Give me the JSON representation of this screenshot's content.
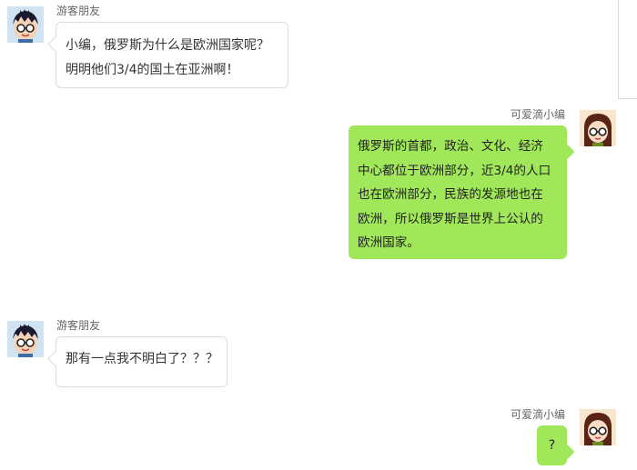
{
  "messages": [
    {
      "sender": "游客朋友",
      "side": "left",
      "lines": [
        "小编，俄罗斯为什么是欧洲国家呢？",
        "明明他们3/4的国土在亚洲啊！"
      ]
    },
    {
      "sender": "可爱滴小编",
      "side": "right",
      "lines": [
        "俄罗斯的首都，政治、文化、经济",
        "中心都位于欧洲部分，近3/4的人口",
        "也在欧洲部分，民族的发源地也在",
        "欧洲，所以俄罗斯是世界上公认的",
        "欧洲国家。"
      ]
    },
    {
      "sender": "游客朋友",
      "side": "left",
      "lines": [
        "那有一点我不明白了？？？"
      ]
    },
    {
      "sender": "可爱滴小编",
      "side": "right",
      "lines": [
        "?"
      ]
    }
  ]
}
